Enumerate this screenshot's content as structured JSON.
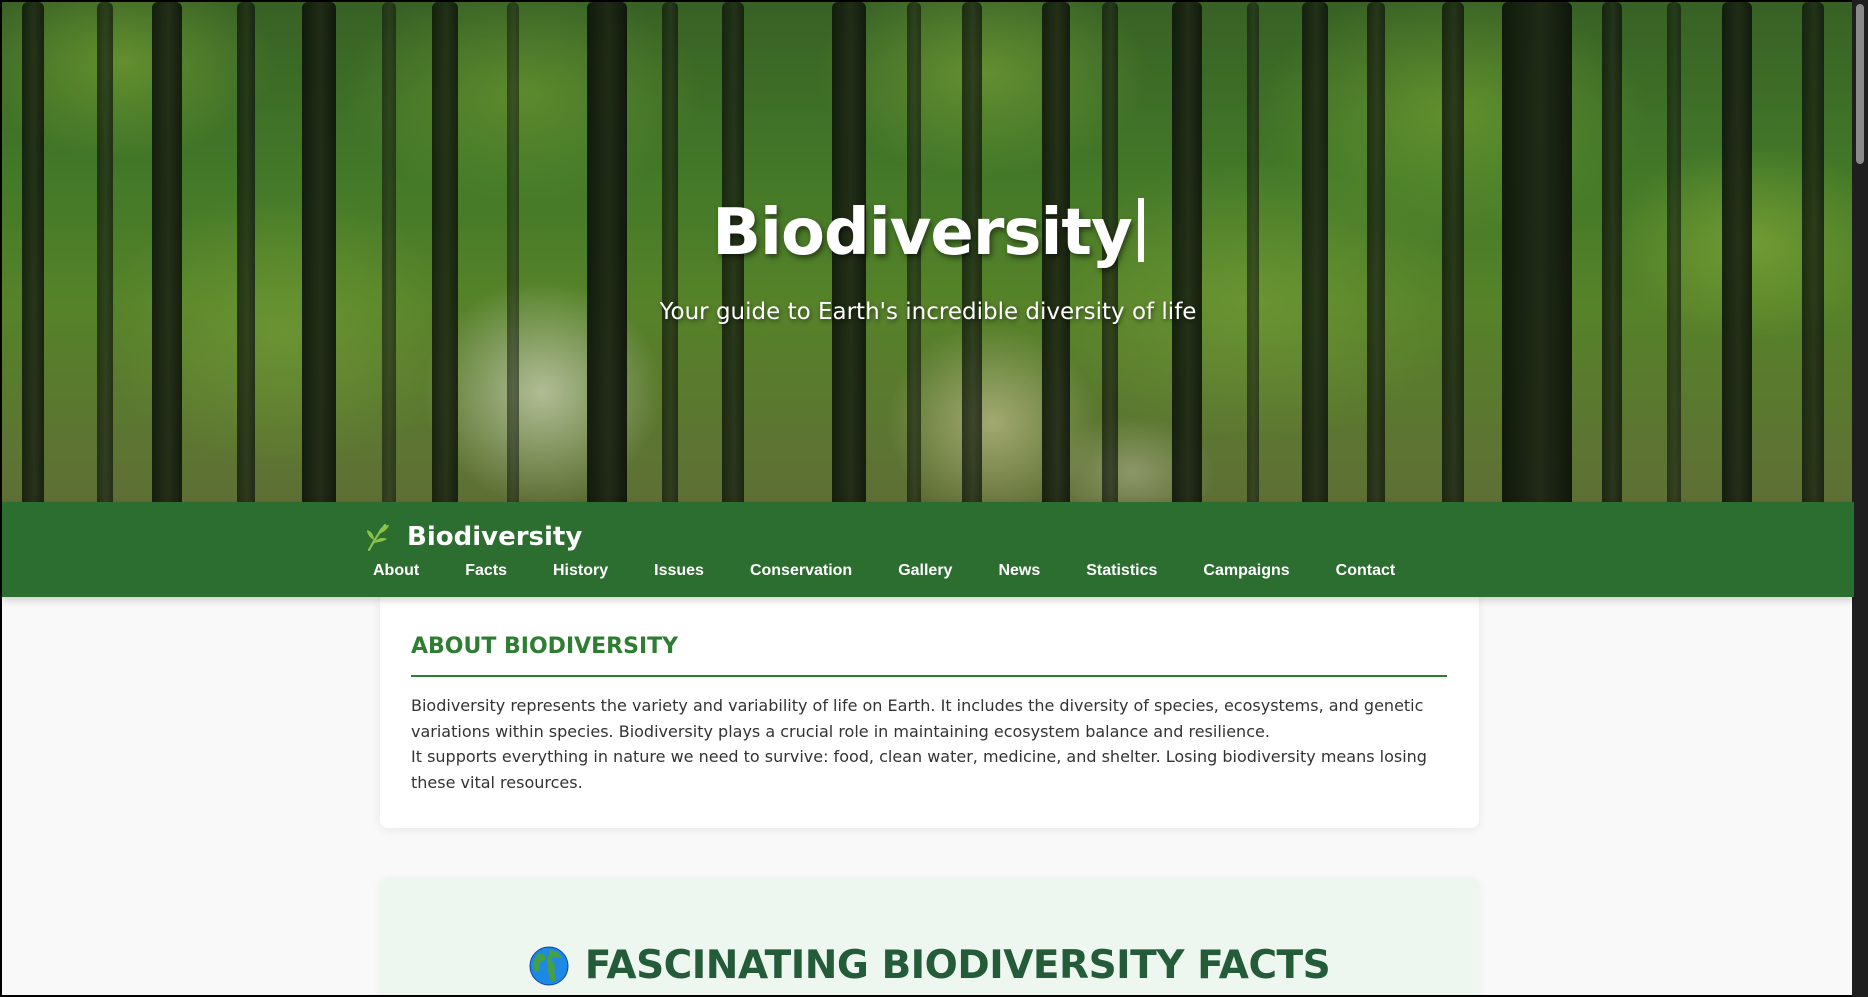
{
  "hero": {
    "title": "Biodiversity",
    "subtitle": "Your guide to Earth's incredible diversity of life"
  },
  "nav": {
    "brand_icon": "leaf-icon",
    "brand_name": "Biodiversity",
    "links": [
      "About",
      "Facts",
      "History",
      "Issues",
      "Conservation",
      "Gallery",
      "News",
      "Statistics",
      "Campaigns",
      "Contact"
    ]
  },
  "about": {
    "heading": "ABOUT BIODIVERSITY",
    "paragraph_1": "Biodiversity represents the variety and variability of life on Earth. It includes the diversity of species, ecosystems, and genetic variations within species. Biodiversity plays a crucial role in maintaining ecosystem balance and resilience.",
    "paragraph_2": "It supports everything in nature we need to survive: food, clean water, medicine, and shelter. Losing biodiversity means losing these vital resources."
  },
  "facts": {
    "icon": "globe-icon",
    "heading": "FASCINATING BIODIVERSITY FACTS"
  },
  "colors": {
    "nav_background": "#2c6e2f",
    "accent_green": "#2e7d32",
    "facts_background": "#eef6f0",
    "facts_heading": "#245c3a"
  }
}
